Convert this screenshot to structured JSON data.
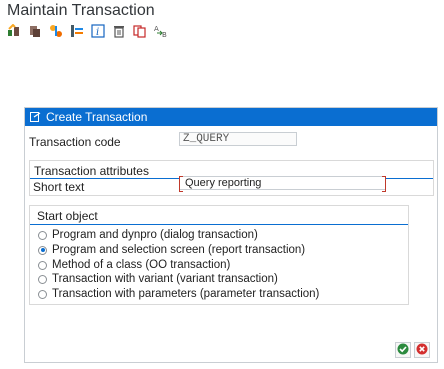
{
  "window": {
    "title": "Maintain Transaction"
  },
  "toolbar": {
    "icons": [
      "display-change-icon",
      "copy-icon",
      "variants-icon",
      "where-used-icon",
      "info-icon",
      "delete-icon",
      "duplicate-icon",
      "translate-icon"
    ]
  },
  "dialog": {
    "title": "Create Transaction",
    "transaction_code_label": "Transaction code",
    "transaction_code_value": "Z_QUERY",
    "attributes_group_title": "Transaction attributes",
    "short_text_label": "Short text",
    "short_text_value": "Query reporting",
    "start_object_title": "Start object",
    "start_options": [
      {
        "label": "Program and dynpro (dialog transaction)",
        "selected": false
      },
      {
        "label": "Program and selection screen (report transaction)",
        "selected": true
      },
      {
        "label": "Method of a class (OO transaction)",
        "selected": false
      },
      {
        "label": "Transaction with variant (variant transaction)",
        "selected": false
      },
      {
        "label": "Transaction with parameters (parameter transaction)",
        "selected": false
      }
    ],
    "footer_buttons": [
      "confirm-icon",
      "cancel-icon"
    ]
  },
  "colors": {
    "accent": "#0a6ed1",
    "confirm": "#2b8a3e",
    "cancel": "#d32f2f"
  }
}
